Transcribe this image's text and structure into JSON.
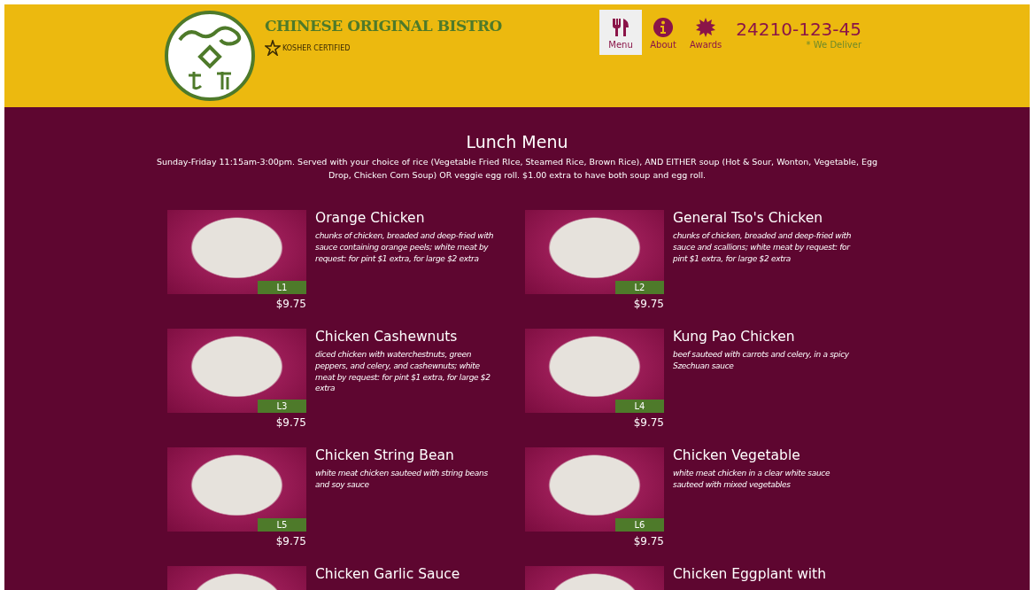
{
  "header": {
    "brand": "CHINESE ORIGINAL BISTRO",
    "badge": "KOSHER CERTIFIED",
    "nav": [
      {
        "label": "Menu",
        "kind": "utensils",
        "selected": true
      },
      {
        "label": "About",
        "kind": "info",
        "selected": false
      },
      {
        "label": "Awards",
        "kind": "burst",
        "selected": false
      }
    ],
    "phone": "24210-123-45",
    "note": "* We Deliver"
  },
  "section": {
    "title": "Lunch Menu",
    "intro": "Sunday-Friday 11:15am-3:00pm. Served with your choice of rice (Vegetable Fried RIce, Steamed Rice, Brown Rice), AND EITHER soup (Hot & Sour, Wonton, Vegetable, Egg Drop, Chicken Corn Soup) OR veggie egg roll. $1.00 extra to have both soup and egg roll."
  },
  "dishes": [
    {
      "name": "Orange Chicken",
      "description": "chunks of chicken, breaded and deep-fried with sauce containing orange peels; white meat by request: for pint $1 extra, for large $2 extra",
      "code": "L1",
      "price": "$9.75"
    },
    {
      "name": "General Tso's Chicken",
      "description": "chunks of chicken, breaded and deep-fried with sauce and scallions; white meat by request: for pint $1 extra, for large $2 extra",
      "code": "L2",
      "price": "$9.75"
    },
    {
      "name": "Chicken Cashewnuts",
      "description": "diced chicken with waterchestnuts, green peppers, and celery, and cashewnuts; white meat by request: for pint $1 extra, for large $2 extra",
      "code": "L3",
      "price": "$9.75"
    },
    {
      "name": "Kung Pao Chicken",
      "description": "beef sauteed with carrots and celery, in a spicy Szechuan sauce",
      "code": "L4",
      "price": "$9.75"
    },
    {
      "name": "Chicken String Bean",
      "description": "white meat chicken sauteed with string beans and soy sauce",
      "code": "L5",
      "price": "$9.75"
    },
    {
      "name": "Chicken Vegetable",
      "description": "white meat chicken in a clear white sauce sauteed with mixed vegetables",
      "code": "L6",
      "price": "$9.75"
    },
    {
      "name": "Chicken Garlic Sauce"
    },
    {
      "name": "Chicken Eggplant with"
    }
  ]
}
